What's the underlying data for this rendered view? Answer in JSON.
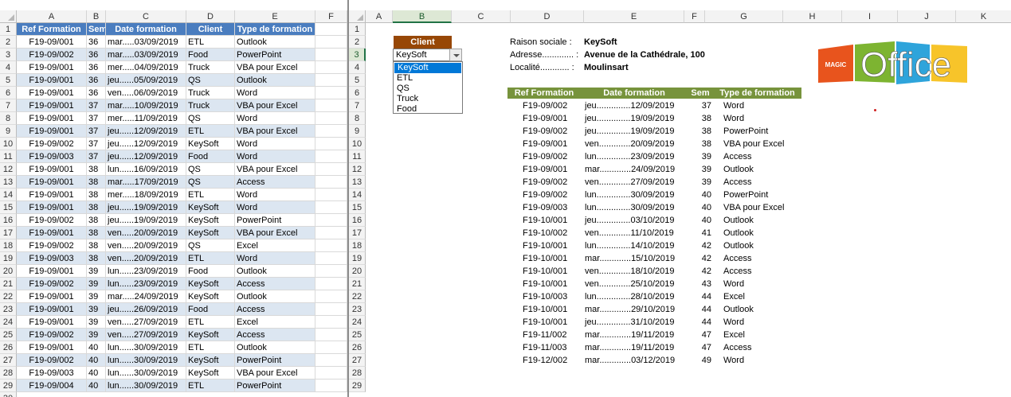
{
  "left_sheet": {
    "columns": [
      "A",
      "B",
      "C",
      "D",
      "E",
      "F"
    ],
    "headers": [
      "Ref Formation",
      "Sem",
      "Date formation",
      "Client",
      "Type de formation"
    ],
    "rows": [
      [
        "F19-09/001",
        "36",
        "mar.....03/09/2019",
        "ETL",
        "Outlook"
      ],
      [
        "F19-09/002",
        "36",
        "mar.....03/09/2019",
        "Food",
        "PowerPoint"
      ],
      [
        "F19-09/001",
        "36",
        "mer.....04/09/2019",
        "Truck",
        "VBA pour Excel"
      ],
      [
        "F19-09/001",
        "36",
        "jeu......05/09/2019",
        "QS",
        "Outlook"
      ],
      [
        "F19-09/001",
        "36",
        "ven.....06/09/2019",
        "Truck",
        "Word"
      ],
      [
        "F19-09/001",
        "37",
        "mar.....10/09/2019",
        "Truck",
        "VBA pour Excel"
      ],
      [
        "F19-09/001",
        "37",
        "mer.....11/09/2019",
        "QS",
        "Word"
      ],
      [
        "F19-09/001",
        "37",
        "jeu......12/09/2019",
        "ETL",
        "VBA pour Excel"
      ],
      [
        "F19-09/002",
        "37",
        "jeu......12/09/2019",
        "KeySoft",
        "Word"
      ],
      [
        "F19-09/003",
        "37",
        "jeu......12/09/2019",
        "Food",
        "Word"
      ],
      [
        "F19-09/001",
        "38",
        "lun......16/09/2019",
        "QS",
        "VBA pour Excel"
      ],
      [
        "F19-09/001",
        "38",
        "mar.....17/09/2019",
        "QS",
        "Access"
      ],
      [
        "F19-09/001",
        "38",
        "mer.....18/09/2019",
        "ETL",
        "Word"
      ],
      [
        "F19-09/001",
        "38",
        "jeu......19/09/2019",
        "KeySoft",
        "Word"
      ],
      [
        "F19-09/002",
        "38",
        "jeu......19/09/2019",
        "KeySoft",
        "PowerPoint"
      ],
      [
        "F19-09/001",
        "38",
        "ven.....20/09/2019",
        "KeySoft",
        "VBA pour Excel"
      ],
      [
        "F19-09/002",
        "38",
        "ven.....20/09/2019",
        "QS",
        "Excel"
      ],
      [
        "F19-09/003",
        "38",
        "ven.....20/09/2019",
        "ETL",
        "Word"
      ],
      [
        "F19-09/001",
        "39",
        "lun......23/09/2019",
        "Food",
        "Outlook"
      ],
      [
        "F19-09/002",
        "39",
        "lun......23/09/2019",
        "KeySoft",
        "Access"
      ],
      [
        "F19-09/001",
        "39",
        "mar.....24/09/2019",
        "KeySoft",
        "Outlook"
      ],
      [
        "F19-09/001",
        "39",
        "jeu......26/09/2019",
        "Food",
        "Access"
      ],
      [
        "F19-09/001",
        "39",
        "ven.....27/09/2019",
        "ETL",
        "Excel"
      ],
      [
        "F19-09/002",
        "39",
        "ven.....27/09/2019",
        "KeySoft",
        "Access"
      ],
      [
        "F19-09/001",
        "40",
        "lun......30/09/2019",
        "ETL",
        "Outlook"
      ],
      [
        "F19-09/002",
        "40",
        "lun......30/09/2019",
        "KeySoft",
        "PowerPoint"
      ],
      [
        "F19-09/003",
        "40",
        "lun......30/09/2019",
        "KeySoft",
        "VBA pour Excel"
      ],
      [
        "F19-09/004",
        "40",
        "lun......30/09/2019",
        "ETL",
        "PowerPoint"
      ]
    ],
    "row_numbers": [
      "1",
      "2",
      "3",
      "4",
      "5",
      "6",
      "7",
      "8",
      "9",
      "10",
      "11",
      "12",
      "13",
      "14",
      "15",
      "16",
      "17",
      "18",
      "19",
      "20",
      "21",
      "22",
      "23",
      "24",
      "25",
      "26",
      "27",
      "28",
      "29",
      "30"
    ]
  },
  "right_sheet": {
    "columns": [
      "A",
      "B",
      "C",
      "D",
      "E",
      "F",
      "G",
      "H",
      "I",
      "J",
      "K"
    ],
    "row_numbers": [
      "1",
      "2",
      "3",
      "4",
      "5",
      "6",
      "7",
      "8",
      "9",
      "10",
      "11",
      "12",
      "13",
      "14",
      "15",
      "16",
      "17",
      "18",
      "19",
      "20",
      "21",
      "22",
      "23",
      "24",
      "25",
      "26",
      "27",
      "28",
      "29"
    ],
    "client_label": "Client",
    "client_value": "KeySoft",
    "client_options": [
      "KeySoft",
      "ETL",
      "QS",
      "Truck",
      "Food"
    ],
    "info": {
      "raison_label": "Raison sociale  :",
      "raison_value": "KeySoft",
      "adresse_label": "Adresse............. :",
      "adresse_value": "Avenue de la Cathédrale, 100",
      "localite_label": "Localité............ :",
      "localite_value": "Moulinsart"
    },
    "table_headers": [
      "Ref Formation",
      "Date formation",
      "Sem",
      "Type de formation"
    ],
    "table_rows": [
      [
        "F19-09/002",
        "jeu..............12/09/2019",
        "37",
        "Word"
      ],
      [
        "F19-09/001",
        "jeu..............19/09/2019",
        "38",
        "Word"
      ],
      [
        "F19-09/002",
        "jeu..............19/09/2019",
        "38",
        "PowerPoint"
      ],
      [
        "F19-09/001",
        "ven.............20/09/2019",
        "38",
        "VBA pour Excel"
      ],
      [
        "F19-09/002",
        "lun..............23/09/2019",
        "39",
        "Access"
      ],
      [
        "F19-09/001",
        "mar.............24/09/2019",
        "39",
        "Outlook"
      ],
      [
        "F19-09/002",
        "ven.............27/09/2019",
        "39",
        "Access"
      ],
      [
        "F19-09/002",
        "lun..............30/09/2019",
        "40",
        "PowerPoint"
      ],
      [
        "F19-09/003",
        "lun..............30/09/2019",
        "40",
        "VBA pour Excel"
      ],
      [
        "F19-10/001",
        "jeu..............03/10/2019",
        "40",
        "Outlook"
      ],
      [
        "F19-10/002",
        "ven.............11/10/2019",
        "41",
        "Outlook"
      ],
      [
        "F19-10/001",
        "lun..............14/10/2019",
        "42",
        "Outlook"
      ],
      [
        "F19-10/001",
        "mar.............15/10/2019",
        "42",
        "Access"
      ],
      [
        "F19-10/001",
        "ven.............18/10/2019",
        "42",
        "Access"
      ],
      [
        "F19-10/001",
        "ven.............25/10/2019",
        "43",
        "Word"
      ],
      [
        "F19-10/003",
        "lun..............28/10/2019",
        "44",
        "Excel"
      ],
      [
        "F19-10/001",
        "mar.............29/10/2019",
        "44",
        "Outlook"
      ],
      [
        "F19-10/001",
        "jeu..............31/10/2019",
        "44",
        "Word"
      ],
      [
        "F19-11/002",
        "mar.............19/11/2019",
        "47",
        "Excel"
      ],
      [
        "F19-11/003",
        "mar.............19/11/2019",
        "47",
        "Access"
      ],
      [
        "F19-12/002",
        "mar.............03/12/2019",
        "49",
        "Word"
      ]
    ],
    "logo": {
      "small_text": "MAGIC",
      "big_text": "Office"
    }
  },
  "colors": {
    "header_blue": "#4a7dbf",
    "band_blue": "#dce6f1",
    "client_brown": "#974706",
    "table_green": "#77933c",
    "selected_blue": "#0078d7"
  }
}
